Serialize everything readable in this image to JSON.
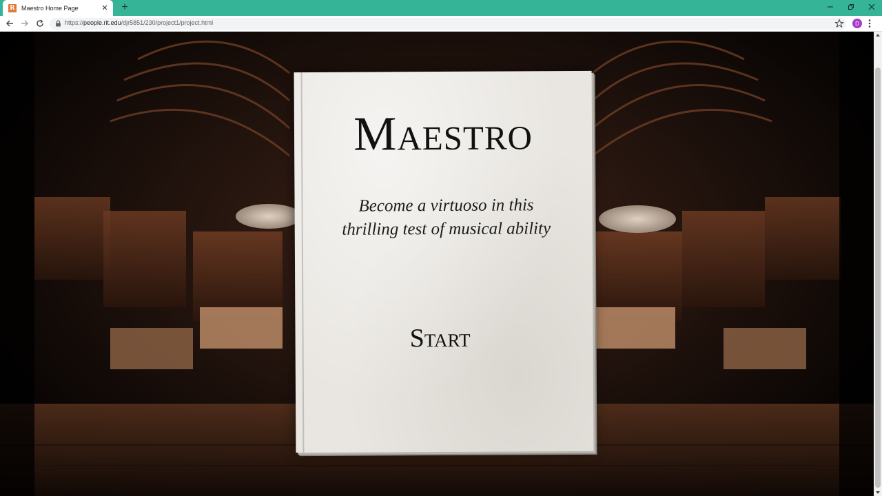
{
  "browser": {
    "tab_title": "Maestro Home Page",
    "favicon_letter": "R",
    "url_scheme": "https://",
    "url_host": "people.rit.edu",
    "url_path": "/djr5851/230/project1/project.html",
    "profile_initial": "D",
    "colors": {
      "frame": "#35b497",
      "profile": "#a53cc7"
    }
  },
  "cover": {
    "title": "Maestro",
    "subtitle_line1": "Become a virtuoso in this",
    "subtitle_line2": "thrilling test of musical ability",
    "start_label": "Start"
  }
}
